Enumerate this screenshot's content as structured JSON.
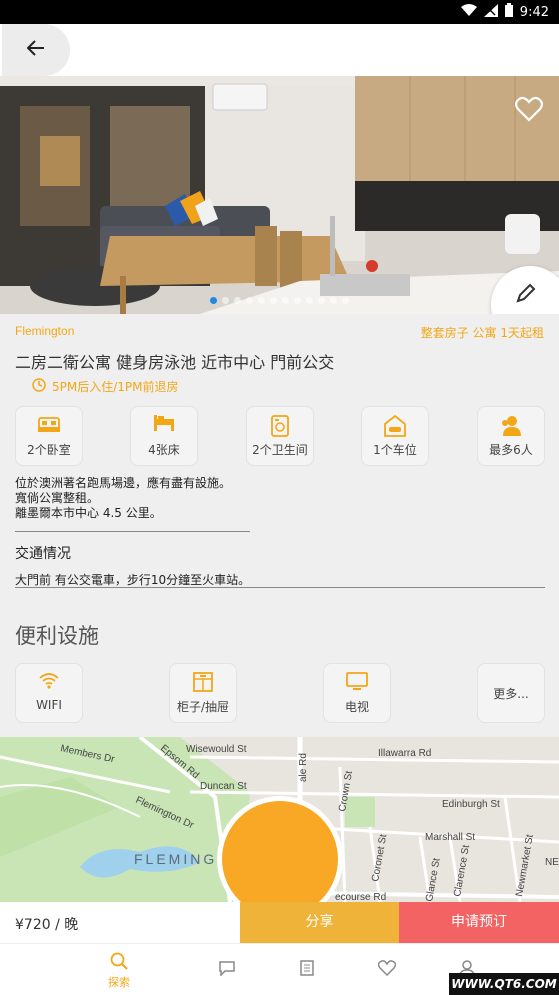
{
  "status_bar": {
    "time": "9:42"
  },
  "listing": {
    "location": "Flemington",
    "tags": "整套房子 公寓 1天起租",
    "title": "二房二衛公寓 健身房泳池 近市中心 門前公交",
    "checkin_text": "5PM后入住/1PM前退房",
    "photo_count": 12,
    "active_photo": 1
  },
  "features": [
    {
      "icon": "bedroom-icon",
      "label": "2个卧室"
    },
    {
      "icon": "bed-icon",
      "label": "4张床"
    },
    {
      "icon": "bathroom-icon",
      "label": "2个卫生间"
    },
    {
      "icon": "parking-icon",
      "label": "1个车位"
    },
    {
      "icon": "guests-icon",
      "label": "最多6人"
    }
  ],
  "description": {
    "lines": [
      "位於澳洲著名跑馬場邊，應有盡有設施。",
      "寬倘公寓整租。",
      "離墨爾本市中心 4.5 公里。"
    ]
  },
  "traffic": {
    "title": "交通情况",
    "text": "大門前 有公交電車，步行10分鐘至火車站。"
  },
  "amenities": {
    "title": "便利设施",
    "items": [
      {
        "icon": "wifi-icon",
        "label": "WIFI"
      },
      {
        "icon": "cabinet-icon",
        "label": "柜子/抽屉"
      },
      {
        "icon": "tv-icon",
        "label": "电视"
      }
    ],
    "more_label": "更多..."
  },
  "map": {
    "streets": [
      "Members Dr",
      "Epsom Rd",
      "Wisewould St",
      "Illawarra Rd",
      "Duncan St",
      "Crown St",
      "Edinburgh St",
      "Flemington Dr",
      "Marshall St",
      "Coronet St",
      "Glance St",
      "Clarence St",
      "Newmarket St",
      "ale Rd",
      "ecourse Rd",
      "NE"
    ],
    "area_label": "FLEMING"
  },
  "booking": {
    "price": "¥720 / 晚",
    "share_label": "分享",
    "book_label": "申请预订"
  },
  "tabs": [
    {
      "icon": "search-icon",
      "label": "探索",
      "active": true
    },
    {
      "icon": "chat-icon",
      "label": ""
    },
    {
      "icon": "document-icon",
      "label": ""
    },
    {
      "icon": "heart-icon",
      "label": ""
    },
    {
      "icon": "profile-icon",
      "label": ""
    }
  ],
  "watermark": "WWW.QT6.COM",
  "colors": {
    "accent": "#f3a717",
    "share": "#f0b33a",
    "book": "#f46363",
    "map_pin": "#f9a825"
  }
}
